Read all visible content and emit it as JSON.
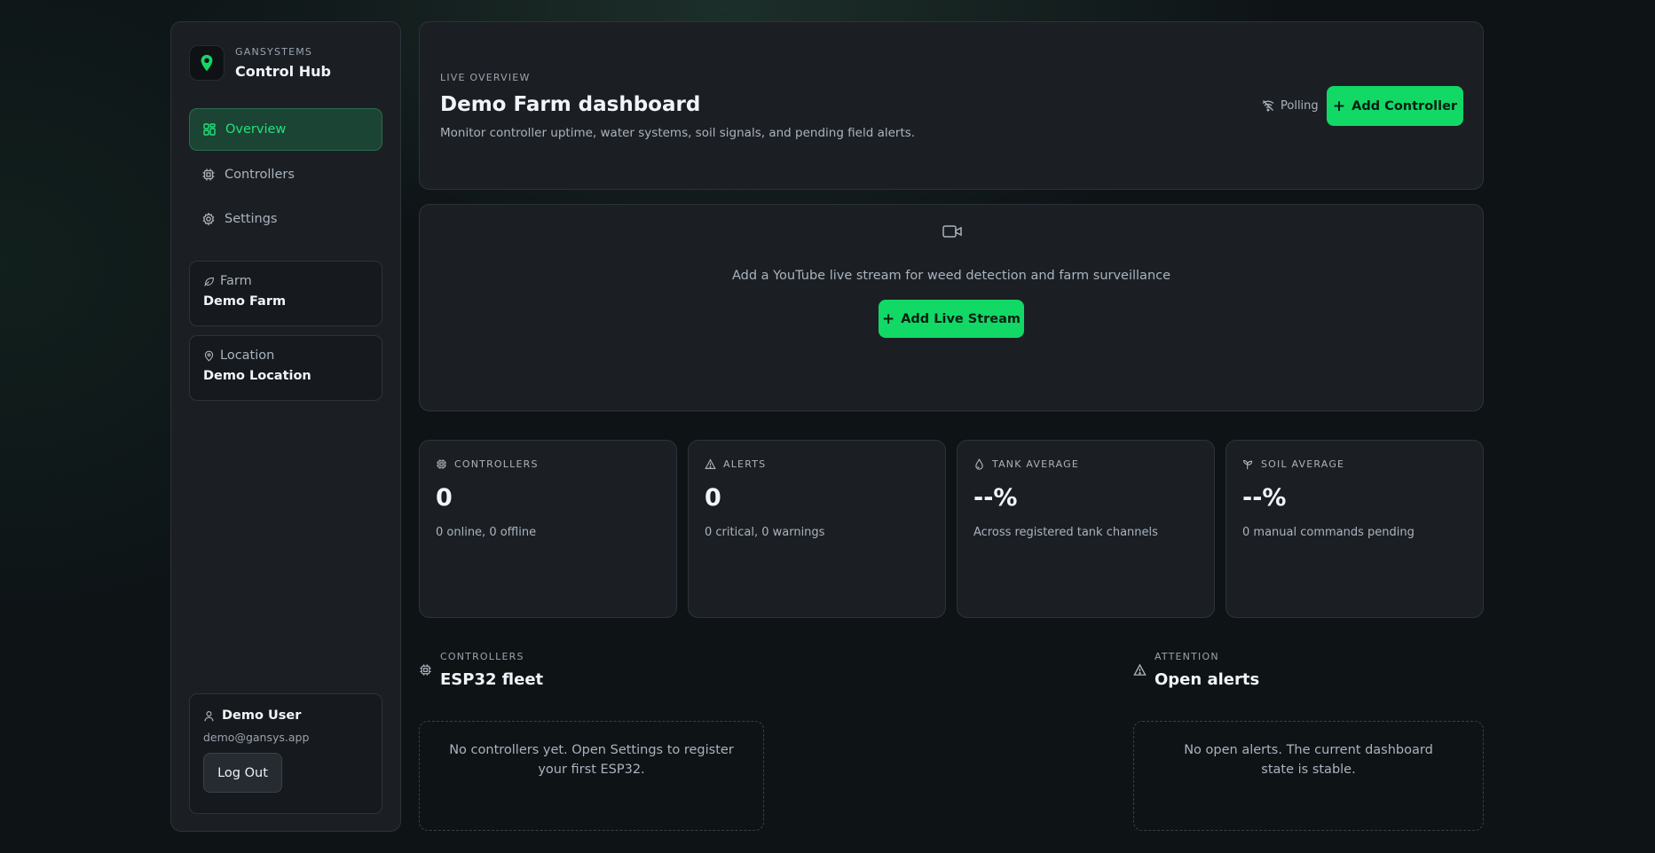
{
  "brand": {
    "eyebrow": "GANSYSTEMS",
    "title": "Control Hub",
    "logo_icon": "map-pin-icon",
    "accent": "#12d866"
  },
  "nav": [
    {
      "label": "Overview",
      "icon": "grid-icon",
      "active": true
    },
    {
      "label": "Controllers",
      "icon": "cpu-icon",
      "active": false
    },
    {
      "label": "Settings",
      "icon": "gear-icon",
      "active": false
    }
  ],
  "farm": {
    "label": "Farm",
    "value": "Demo Farm",
    "icon": "leaf-icon"
  },
  "location": {
    "label": "Location",
    "value": "Demo Location",
    "icon": "pin-icon"
  },
  "user": {
    "name": "Demo User",
    "email": "demo@gansys.app",
    "logout_label": "Log Out",
    "icon": "user-icon"
  },
  "header": {
    "eyebrow": "LIVE OVERVIEW",
    "title": "Demo Farm dashboard",
    "subtitle": "Monitor controller uptime, water systems, soil signals, and pending field alerts.",
    "polling_label": "Polling",
    "add_controller_label": "Add Controller"
  },
  "stream": {
    "icon": "video-icon",
    "text": "Add a YouTube live stream for weed detection and farm surveillance",
    "button_label": "Add Live Stream"
  },
  "stats": [
    {
      "label": "CONTROLLERS",
      "value": "0",
      "sub": "0 online, 0 offline",
      "icon": "cpu-icon"
    },
    {
      "label": "ALERTS",
      "value": "0",
      "sub": "0 critical, 0 warnings",
      "icon": "warning-icon"
    },
    {
      "label": "TANK AVERAGE",
      "value": "--%",
      "sub": "Across registered tank channels",
      "icon": "droplet-icon"
    },
    {
      "label": "SOIL AVERAGE",
      "value": "--%",
      "sub": "0 manual commands pending",
      "icon": "sprout-icon"
    }
  ],
  "controllers_section": {
    "eyebrow": "CONTROLLERS",
    "title": "ESP32 fleet",
    "empty_text": "No controllers yet. Open Settings to register your first ESP32."
  },
  "alerts_section": {
    "eyebrow": "ATTENTION",
    "title": "Open alerts",
    "empty_text": "No open alerts. The current dashboard state is stable."
  }
}
